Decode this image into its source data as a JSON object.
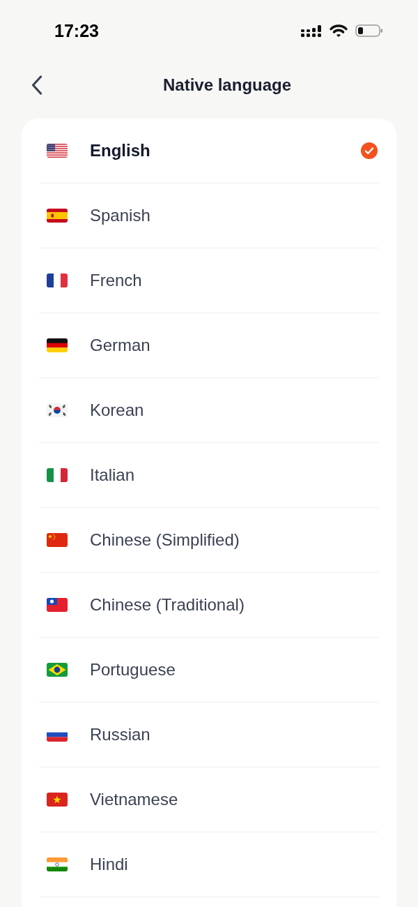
{
  "status_bar": {
    "time": "17:23"
  },
  "header": {
    "title": "Native language"
  },
  "languages": [
    {
      "name": "English",
      "kind": "us",
      "selected": true
    },
    {
      "name": "Spanish",
      "kind": "es",
      "selected": false
    },
    {
      "name": "French",
      "kind": "fr",
      "selected": false
    },
    {
      "name": "German",
      "kind": "de",
      "selected": false
    },
    {
      "name": "Korean",
      "kind": "kr",
      "selected": false
    },
    {
      "name": "Italian",
      "kind": "it",
      "selected": false
    },
    {
      "name": "Chinese (Simplified)",
      "kind": "cn",
      "selected": false
    },
    {
      "name": "Chinese (Traditional)",
      "kind": "tw",
      "selected": false
    },
    {
      "name": "Portuguese",
      "kind": "br",
      "selected": false
    },
    {
      "name": "Russian",
      "kind": "ru",
      "selected": false
    },
    {
      "name": "Vietnamese",
      "kind": "vn",
      "selected": false
    },
    {
      "name": "Hindi",
      "kind": "in",
      "selected": false
    }
  ]
}
